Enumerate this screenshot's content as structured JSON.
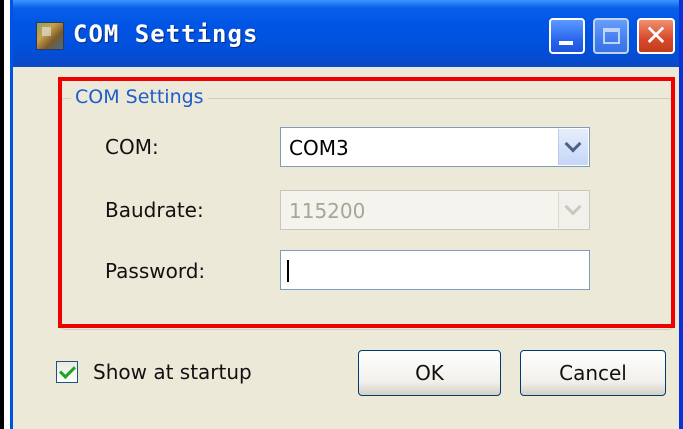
{
  "window": {
    "title": "COM Settings",
    "icon": "app-icon",
    "controls": [
      "minimize-icon",
      "maximize-icon",
      "close-icon"
    ]
  },
  "group": {
    "title": "COM Settings",
    "highlight_color": "#ee0000"
  },
  "fields": {
    "com": {
      "label": "COM:",
      "value": "COM3"
    },
    "baudrate": {
      "label": "Baudrate:",
      "value": "115200",
      "disabled": true
    },
    "password": {
      "label": "Password:",
      "value": ""
    }
  },
  "show_at_startup": {
    "label": "Show at startup",
    "checked": true
  },
  "buttons": {
    "ok": "OK",
    "cancel": "Cancel"
  }
}
